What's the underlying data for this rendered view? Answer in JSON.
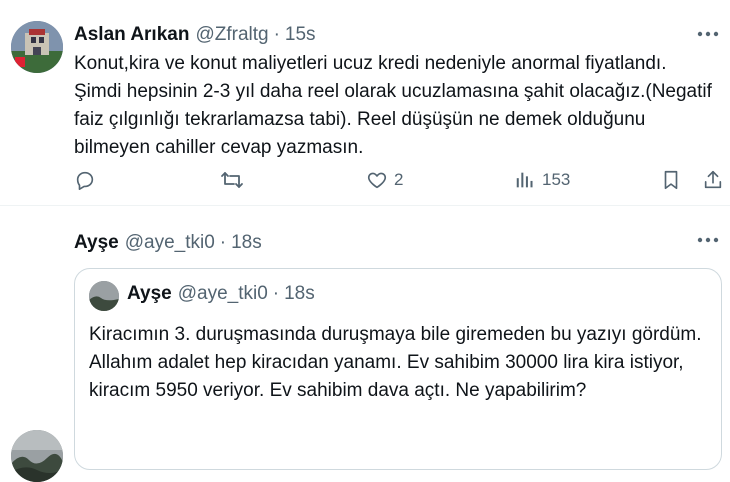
{
  "posts": [
    {
      "author": "Aslan Arıkan",
      "handle": "@Zfraltg",
      "dot": "·",
      "time": "15s",
      "lines": [
        "Konut,kira ve konut maliyetleri ucuz kredi nedeniyle anormal fiyatlandı.",
        "Şimdi hepsinin 2-3 yıl daha reel olarak ucuzlamasına şahit olacağız.(Negatif",
        "faiz çılgınlığı tekrarlamazsa tabi). Reel düşüşün ne demek olduğunu",
        "bilmeyen cahiller cevap yazmasın."
      ],
      "actions": {
        "reply_icon": "reply-icon",
        "retweet_icon": "retweet-icon",
        "like_icon": "heart-icon",
        "like_count": "2",
        "views_icon": "views-icon",
        "views_count": "153",
        "bookmark_icon": "bookmark-icon",
        "share_icon": "share-icon"
      }
    },
    {
      "author": "Ayşe",
      "handle": "@aye_tki0",
      "dot": "·",
      "time": "18s",
      "quote": {
        "author": "Ayşe",
        "handle": "@aye_tki0",
        "dot": "·",
        "time": "18s",
        "lines": [
          "Kiracımın 3. duruşmasında duruşmaya bile giremeden bu yazıyı gördüm.",
          "Allahım adalet hep kiracıdan yanamı. Ev sahibim 30000 lira kira istiyor,",
          "kiracım 5950 veriyor. Ev sahibim dava açtı. Ne yapabilirim?"
        ]
      }
    }
  ],
  "colors": {
    "text": "#0f1419",
    "secondary": "#536471",
    "border": "#cfd9de"
  }
}
